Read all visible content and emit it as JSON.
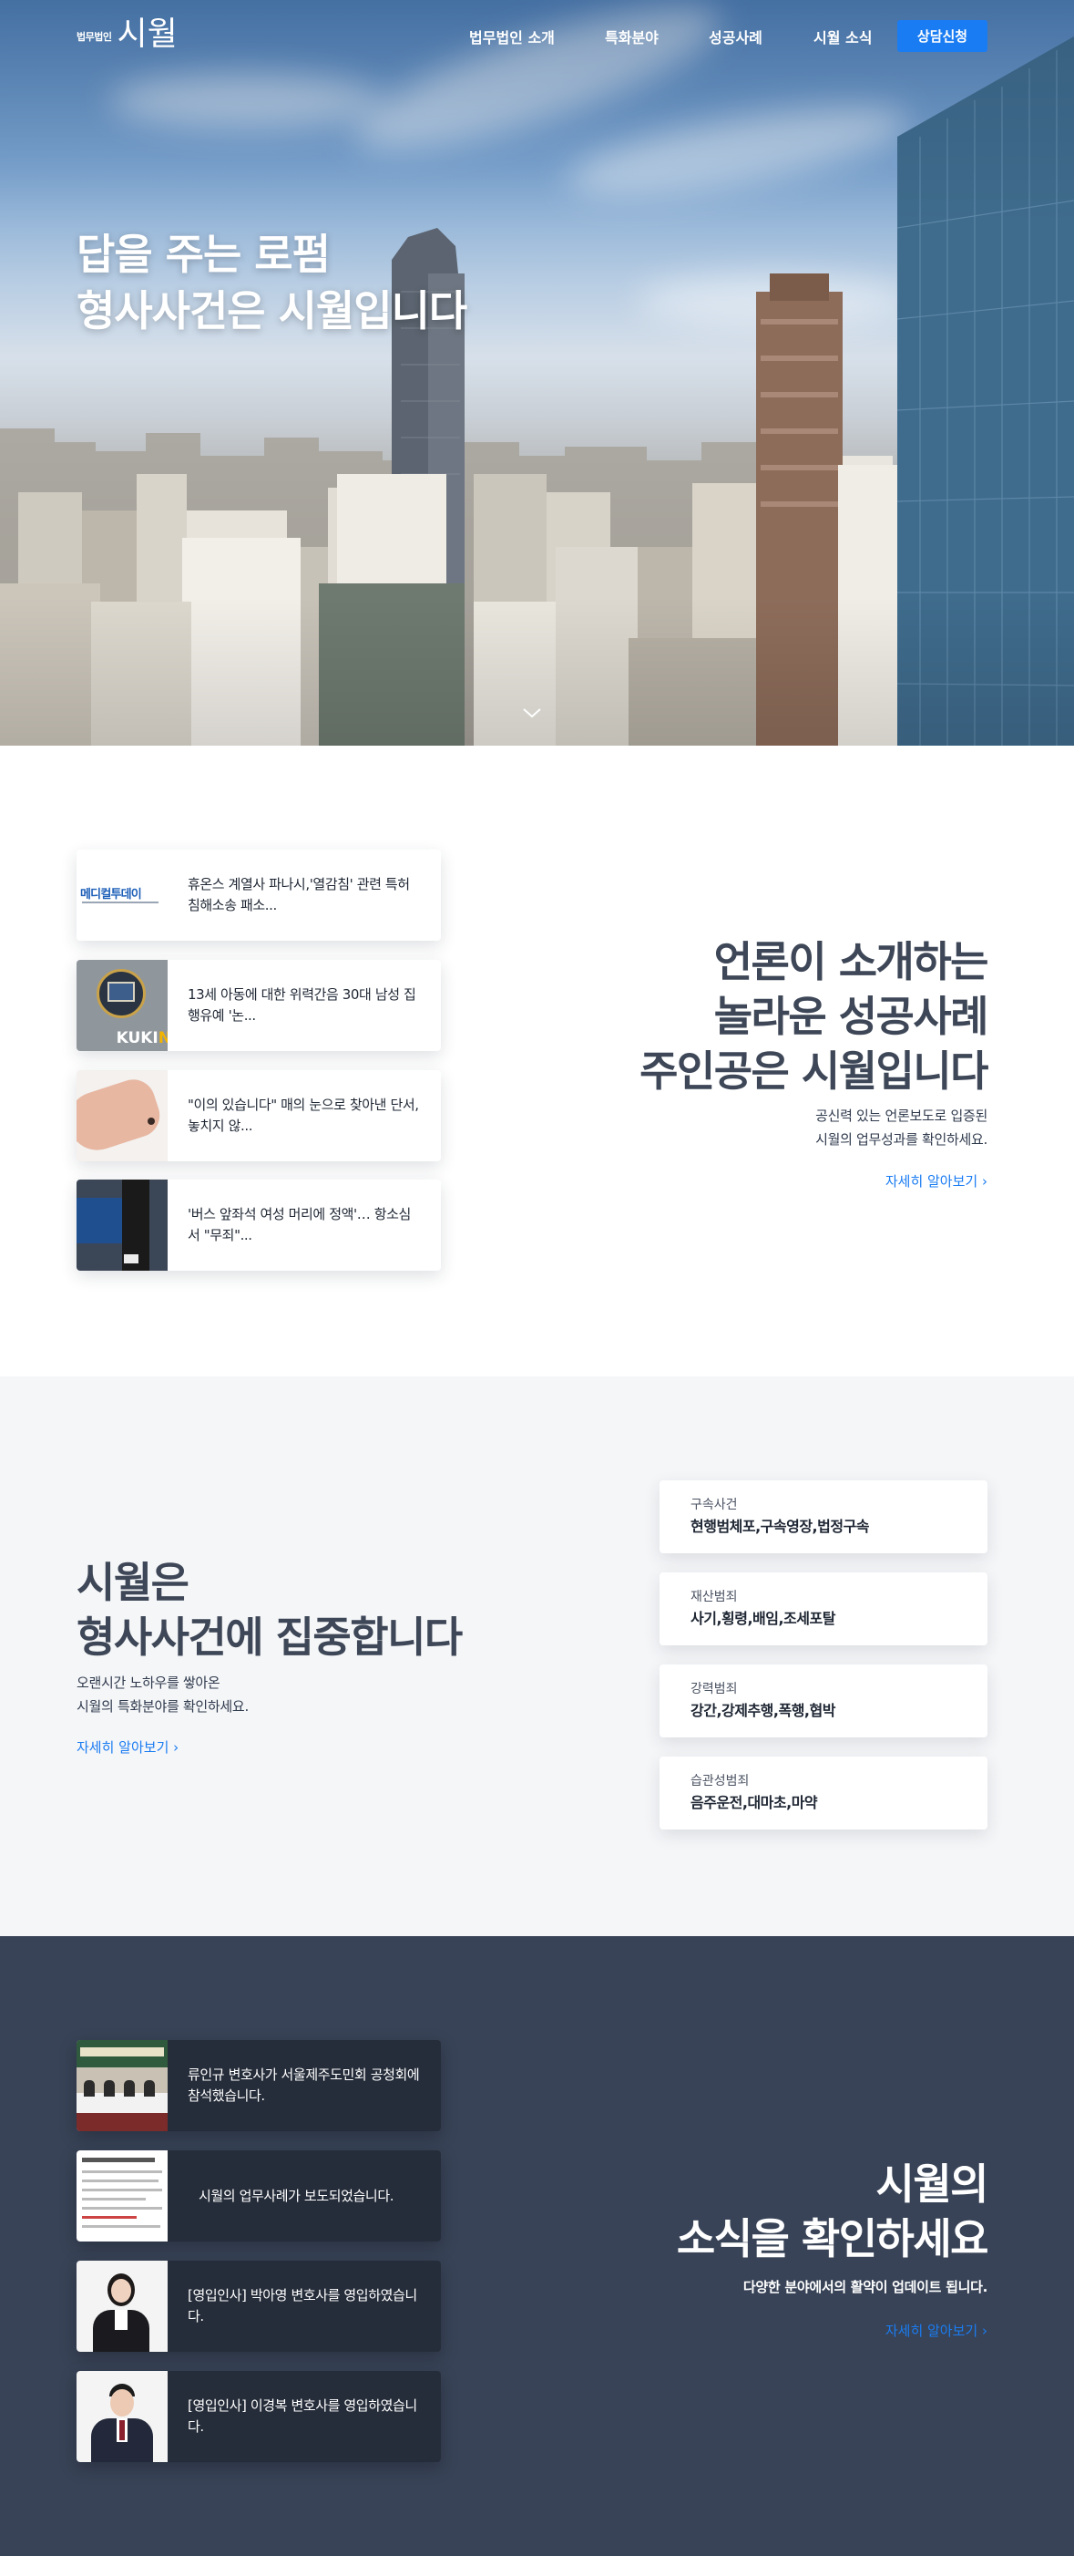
{
  "nav": {
    "logo_sub": "법무법인",
    "logo_main": "시월",
    "items": [
      {
        "label": "법무법인 소개"
      },
      {
        "label": "특화분야"
      },
      {
        "label": "성공사례"
      },
      {
        "label": "시월 소식"
      }
    ],
    "cta_label": "상담신청"
  },
  "hero": {
    "title_line1": "답을 주는 로펌",
    "title_line2": "형사사건은 시월입니다"
  },
  "press": {
    "heading_line1": "언론이 소개하는",
    "heading_line2": "놀라운 성공사례",
    "heading_line3": "주인공은 시월입니다",
    "desc_line1": "공신력 있는 언론보도로 입증된",
    "desc_line2": "시월의 업무성과를 확인하세요.",
    "more_label": "자세히 알아보기",
    "cards": [
      {
        "title": "휴온스 계열사 파나시,'열감침' 관련 특허침해소송 패소...",
        "thumb_text": "메디컬투데이"
      },
      {
        "title": "13세 아동에 대한 위력간음 30대 남성 집행유예 '논...",
        "thumb_text": "KUKI"
      },
      {
        "title": "\"이의 있습니다\" 매의 눈으로 찾아낸 단서, 놓치지 않...",
        "thumb_text": ""
      },
      {
        "title": "'버스 앞좌석 여성 머리에 정액'… 항소심서 \"무죄\"...",
        "thumb_text": ""
      }
    ]
  },
  "focus": {
    "heading_line1": "시월은",
    "heading_line2": "형사사건에 집중합니다",
    "desc_line1": "오랜시간 노하우를 쌓아온",
    "desc_line2": "시월의 특화분야를 확인하세요.",
    "more_label": "자세히 알아보기",
    "categories": [
      {
        "title": "구속사건",
        "items": "현행범체포,구속영장,법정구속"
      },
      {
        "title": "재산범죄",
        "items": "사기,횡령,배임,조세포탈"
      },
      {
        "title": "강력범죄",
        "items": "강간,강제추행,폭행,협박"
      },
      {
        "title": "습관성범죄",
        "items": "음주운전,대마초,마약"
      }
    ]
  },
  "news": {
    "heading_line1": "시월의",
    "heading_line2": "소식을 확인하세요",
    "desc": "다양한 분야에서의 활약이 업데이트 됩니다.",
    "more_label": "자세히 알아보기",
    "cards": [
      {
        "title": "류인규 변호사가 서울제주도민회 공청회에 참석했습니다."
      },
      {
        "title": "시월의 업무사례가 보도되었습니다."
      },
      {
        "title": "[영입인사] 박아영 변호사를 영입하였습니다."
      },
      {
        "title": "[영입인사] 이경복 변호사를 영입하였습니다."
      }
    ]
  },
  "colors": {
    "accent": "#1a7cf2",
    "dark_section": "#384357",
    "dark_card": "#262d3a",
    "light_section": "#f5f6f8"
  }
}
